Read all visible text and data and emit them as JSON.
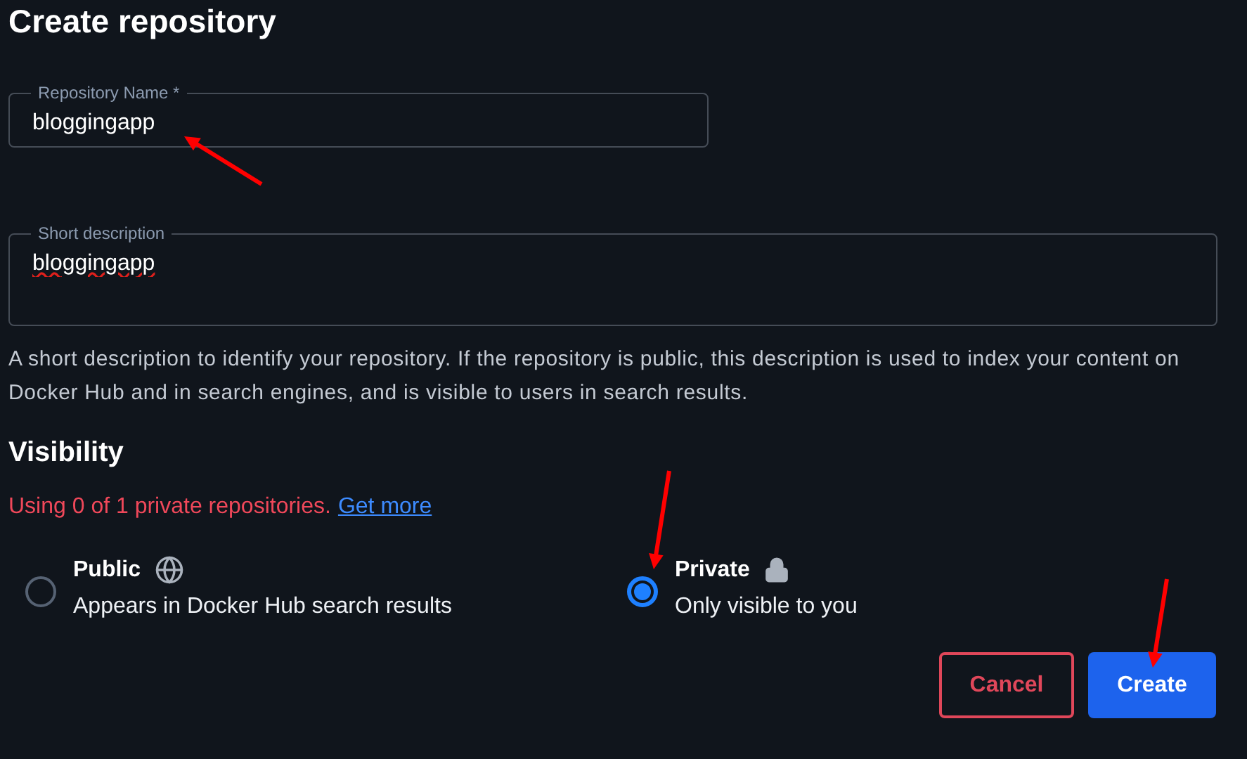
{
  "title": "Create repository",
  "name_field": {
    "label": "Repository Name *",
    "value": "bloggingapp"
  },
  "description_field": {
    "label": "Short description",
    "value": "bloggingapp",
    "misspelled": true
  },
  "description_help": "A short description to identify your repository. If the repository is public, this description is used to index your content on Docker Hub and in search engines, and is visible to users in search results.",
  "visibility": {
    "heading": "Visibility",
    "usage": "Using 0 of 1 private repositories.",
    "link": "Get more",
    "options": [
      {
        "kind": "public",
        "label": "Public",
        "description": "Appears in Docker Hub search results",
        "selected": false
      },
      {
        "kind": "private",
        "label": "Private",
        "description": "Only visible to you",
        "selected": true
      }
    ]
  },
  "buttons": [
    {
      "kind": "cancel",
      "label": "Cancel"
    },
    {
      "kind": "create",
      "label": "Create"
    }
  ]
}
